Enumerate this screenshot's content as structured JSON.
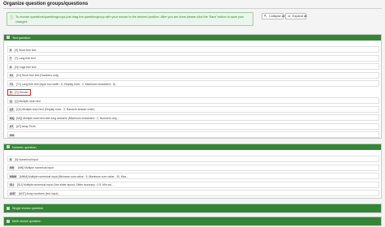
{
  "page": {
    "title": "Organize question groups/questions"
  },
  "info": {
    "line1": "To reorder questions/questiongroups just drag the question/group with your mouse to the desired position. After you are done please click the 'Save' button to save your",
    "line2": "changes."
  },
  "toolbar": {
    "collapse_label": "Collapse all",
    "expand_label": "Expand all"
  },
  "groups": [
    {
      "title": "Text question",
      "questions": [
        {
          "code": "S",
          "text": "[S] Short free text"
        },
        {
          "code": "T",
          "text": "[T] Long free text"
        },
        {
          "code": "H",
          "text": "[H] Huge free text"
        },
        {
          "code": "S1",
          "text": "[S1] Short free text (Numbers only)"
        },
        {
          "code": "T1",
          "text": "[T1] Long free text (Input box width : 6, Display rows : 2, Maximum characters : 6)"
        },
        {
          "code": "G",
          "text": "[G] Gender"
        },
        {
          "code": "Q",
          "text": "[Q] Multiple short text"
        },
        {
          "code": "Q1",
          "text": "[Q1] Multiple short text (Display rows : 3, Random answer order)"
        },
        {
          "code": "MQ",
          "text": "[MQ] Multiple short text with long answers (Maximum characters : 2, Numbers only,..."
        },
        {
          "code": "AT",
          "text": "[AT] Array Texts"
        },
        {
          "code": "Hid",
          "text": "[Hid]"
        }
      ]
    },
    {
      "title": "Numeric question",
      "questions": [
        {
          "code": "N",
          "text": "[N] Numerical input"
        },
        {
          "code": "MN",
          "text": "[MN] Multiple numerical input"
        },
        {
          "code": "MNM",
          "text": "[MNM] Multiple numerical input (Minimum sum value : 5, Maximum sum value : 10, Max..."
        },
        {
          "code": "SLI",
          "text": "[SLI] Multiple numerical input (Use slider layout, Slider accuracy : 0.5, Min val..."
        },
        {
          "code": "ANT",
          "text": "[ANT] Array numbers (text input)"
        }
      ]
    },
    {
      "title": "Single choice question",
      "questions": []
    },
    {
      "title": "Multi choice question",
      "questions": []
    }
  ]
}
